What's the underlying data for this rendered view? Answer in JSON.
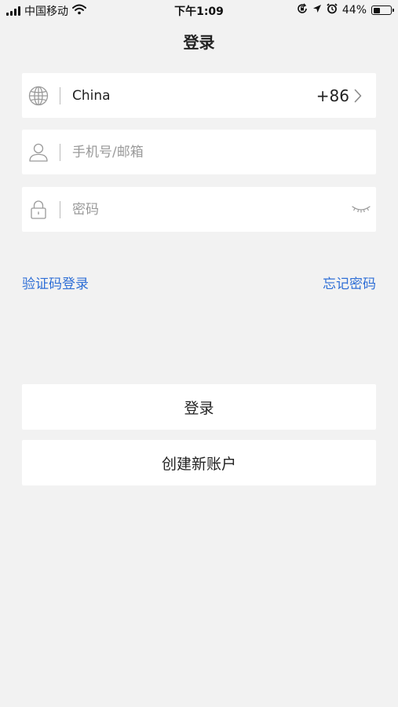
{
  "status_bar": {
    "carrier": "中国移动",
    "time": "下午1:09",
    "battery_percent_text": "44%",
    "battery_level": 0.44,
    "icons": [
      "signal-icon",
      "wifi-icon",
      "orientation-lock-icon",
      "location-icon",
      "alarm-icon",
      "battery-icon"
    ]
  },
  "header": {
    "title": "登录"
  },
  "form": {
    "country": {
      "icon": "globe-icon",
      "name": "China",
      "code": "+86"
    },
    "account": {
      "icon": "user-icon",
      "placeholder": "手机号/邮箱",
      "value": ""
    },
    "password": {
      "icon": "lock-icon",
      "placeholder": "密码",
      "value": "",
      "toggle_icon": "eye-closed-icon"
    }
  },
  "links": {
    "code_login": "验证码登录",
    "forgot_password": "忘记密码"
  },
  "buttons": {
    "login": "登录",
    "create_account": "创建新账户"
  },
  "colors": {
    "background": "#f2f2f2",
    "link": "#2f6fd6",
    "card": "#ffffff"
  }
}
